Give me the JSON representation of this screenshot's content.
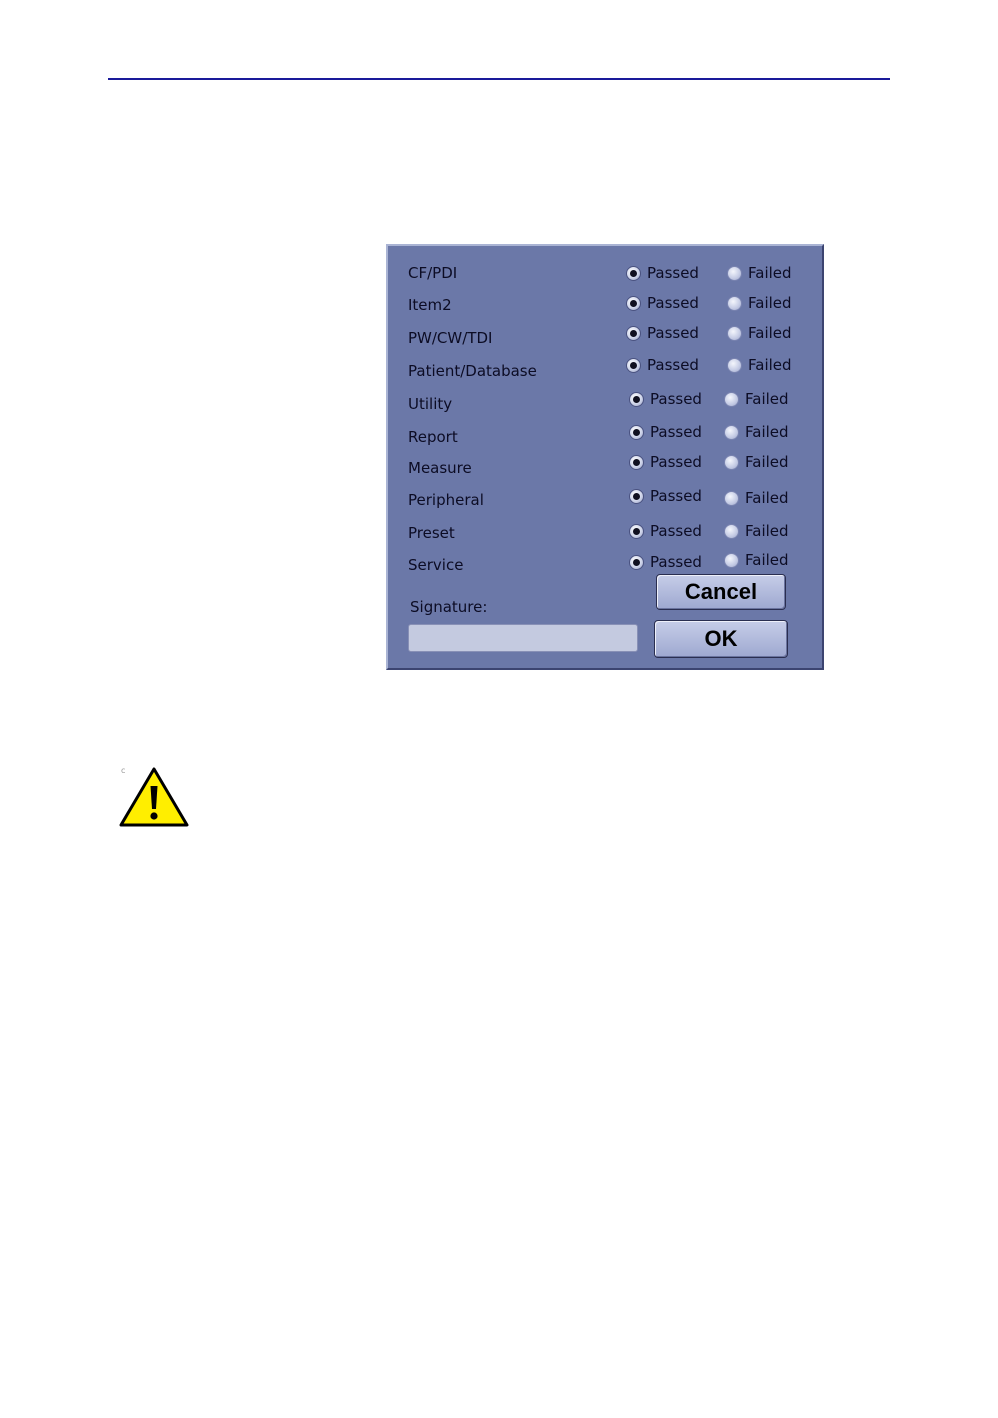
{
  "dialog": {
    "rows": [
      {
        "label": "CF/PDI",
        "passed": "Passed",
        "failed": "Failed",
        "selected": "passed"
      },
      {
        "label": "Item2",
        "passed": "Passed",
        "failed": "Failed",
        "selected": "passed"
      },
      {
        "label": "PW/CW/TDI",
        "passed": "Passed",
        "failed": "Failed",
        "selected": "passed"
      },
      {
        "label": "Patient/Database",
        "passed": "Passed",
        "failed": "Failed",
        "selected": "passed"
      },
      {
        "label": "Utility",
        "passed": "Passed",
        "failed": "Failed",
        "selected": "passed"
      },
      {
        "label": "Report",
        "passed": "Passed",
        "failed": "Failed",
        "selected": "passed"
      },
      {
        "label": "Measure",
        "passed": "Passed",
        "failed": "Failed",
        "selected": "passed"
      },
      {
        "label": "Peripheral",
        "passed": "Passed",
        "failed": "Failed",
        "selected": "passed"
      },
      {
        "label": "Preset",
        "passed": "Passed",
        "failed": "Failed",
        "selected": "passed"
      },
      {
        "label": "Service",
        "passed": "Passed",
        "failed": "Failed",
        "selected": "passed"
      }
    ],
    "signature_label": "Signature:",
    "signature_value": "",
    "cancel_label": "Cancel",
    "ok_label": "OK"
  },
  "page": {
    "tiny_mark": "c"
  },
  "colors": {
    "rule": "#1a1a9a",
    "dialog_bg": "#6b78a8",
    "warning_yellow": "#ffee00"
  },
  "icons": {
    "caution": "caution-triangle-icon"
  }
}
